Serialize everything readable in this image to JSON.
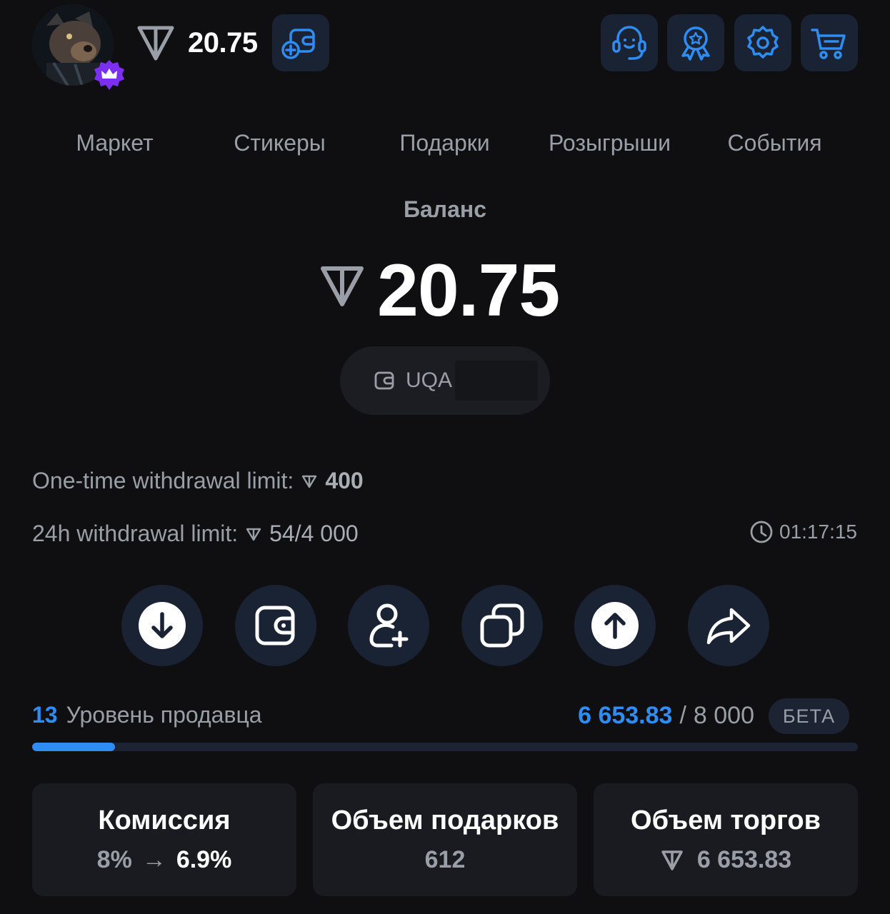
{
  "header": {
    "balance": "20.75",
    "icons": [
      "wallet-add-icon",
      "support-icon",
      "badge-icon",
      "settings-icon",
      "cart-icon"
    ]
  },
  "tabs": [
    "Маркет",
    "Стикеры",
    "Подарки",
    "Розыгрыши",
    "События"
  ],
  "balance": {
    "label": "Баланс",
    "amount": "20.75",
    "wallet_address": "UQA"
  },
  "limits": {
    "one_time_label": "One-time withdrawal limit:",
    "one_time_value": "400",
    "daily_label": "24h withdrawal limit:",
    "daily_value": "54/4 000",
    "timer": "01:17:15"
  },
  "actions": [
    "deposit-icon",
    "wallet-icon",
    "invite-icon",
    "copy-icon",
    "withdraw-icon",
    "share-icon"
  ],
  "seller_level": {
    "level": "13",
    "label": "Уровень продавца",
    "current": "6 653.83",
    "separator": "/",
    "target": "8 000",
    "badge": "БЕТА",
    "progress_fraction": 0.1
  },
  "stats": {
    "commission_title": "Комиссия",
    "commission_old": "8%",
    "commission_new": "6.9%",
    "gifts_title": "Объем подарков",
    "gifts_value": "612",
    "trade_title": "Объем торгов",
    "trade_value": "6 653.83"
  },
  "colors": {
    "accent": "#2f8cf2",
    "background": "#0f0f11",
    "crown_badge": "#7b2ff2"
  }
}
